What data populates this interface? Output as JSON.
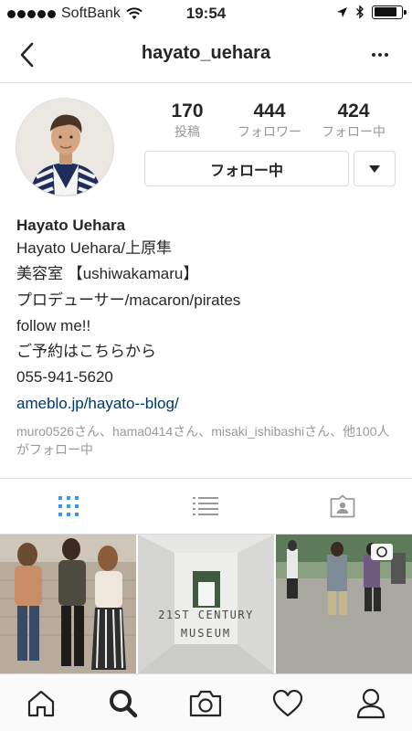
{
  "status_bar": {
    "carrier": "SoftBank",
    "time": "19:54",
    "battery_level": 0.85
  },
  "nav": {
    "title": "hayato_uehara"
  },
  "profile": {
    "stats": [
      {
        "value": "170",
        "label": "投稿"
      },
      {
        "value": "444",
        "label": "フォロワー"
      },
      {
        "value": "424",
        "label": "フォロー中"
      }
    ],
    "follow_button_label": "フォロー中"
  },
  "bio": {
    "name": "Hayato Uehara",
    "lines": [
      "Hayato Uehara/上原隼",
      "美容室 【ushiwakamaru】",
      "プロデューサー/macaron/pirates",
      "follow me!!",
      "ご予約はこちらから",
      "055-941-5620"
    ],
    "link": "ameblo.jp/hayato--blog/",
    "followed_by": "muro0526さん、hama0414さん、misaki_ishibashiさん、他100人がフォロー中"
  },
  "photos": [
    {
      "caption": ""
    },
    {
      "caption": "21ST CENTURY MUSEUM"
    },
    {
      "caption": ""
    }
  ],
  "colors": {
    "active_tab": "#3897f0",
    "link": "#003569",
    "muted": "#999999",
    "border": "#dbdbdb"
  }
}
